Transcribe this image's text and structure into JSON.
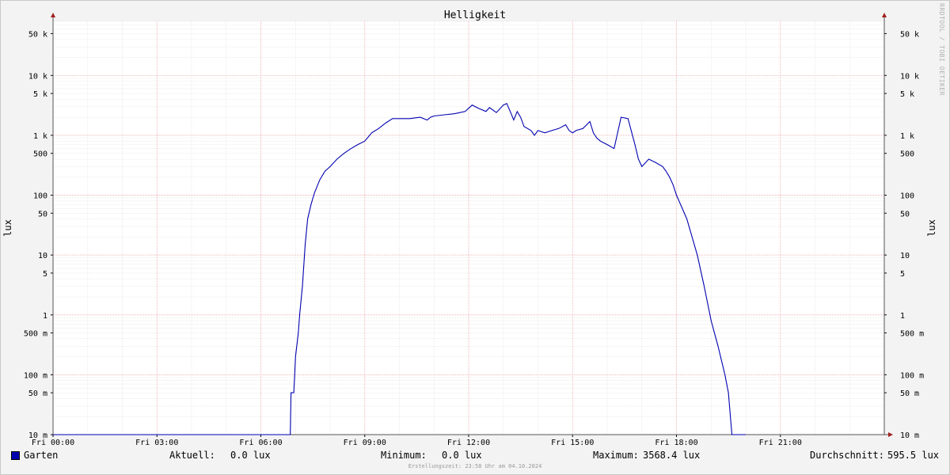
{
  "chart_data": {
    "type": "line",
    "title": "Helligkeit",
    "ylabel": "lux",
    "yscale": "log",
    "ylim": [
      0.01,
      80000
    ],
    "xlim_hours": [
      0,
      24
    ],
    "x_tick_labels": [
      "Fri 00:00",
      "Fri 03:00",
      "Fri 06:00",
      "Fri 09:00",
      "Fri 12:00",
      "Fri 15:00",
      "Fri 18:00",
      "Fri 21:00"
    ],
    "y_ticks": [
      {
        "value": 50000,
        "label": "50 k"
      },
      {
        "value": 10000,
        "label": "10 k"
      },
      {
        "value": 5000,
        "label": "5 k"
      },
      {
        "value": 1000,
        "label": "1 k"
      },
      {
        "value": 500,
        "label": "500"
      },
      {
        "value": 100,
        "label": "100"
      },
      {
        "value": 50,
        "label": "50"
      },
      {
        "value": 10,
        "label": "10"
      },
      {
        "value": 5,
        "label": "5"
      },
      {
        "value": 1,
        "label": "1"
      },
      {
        "value": 0.5,
        "label": "500 m"
      },
      {
        "value": 0.1,
        "label": "100 m"
      },
      {
        "value": 0.05,
        "label": "50 m"
      },
      {
        "value": 0.01,
        "label": "10 m"
      }
    ],
    "grid": true,
    "series": [
      {
        "name": "Garten",
        "color": "#0000b0",
        "x_hours": [
          0,
          1,
          2,
          3,
          4,
          5,
          6,
          6.85,
          6.87,
          6.95,
          7.0,
          7.08,
          7.12,
          7.2,
          7.28,
          7.35,
          7.45,
          7.55,
          7.7,
          7.85,
          8.0,
          8.2,
          8.4,
          8.6,
          8.8,
          9.0,
          9.2,
          9.4,
          9.6,
          9.8,
          9.9,
          10.0,
          10.3,
          10.6,
          10.8,
          10.9,
          11.0,
          11.3,
          11.6,
          11.9,
          12.1,
          12.3,
          12.5,
          12.6,
          12.8,
          13.0,
          13.1,
          13.2,
          13.3,
          13.4,
          13.5,
          13.6,
          13.7,
          13.8,
          13.9,
          14.0,
          14.2,
          14.4,
          14.6,
          14.8,
          14.9,
          15.0,
          15.1,
          15.3,
          15.5,
          15.6,
          15.7,
          15.8,
          16.0,
          16.2,
          16.4,
          16.6,
          16.8,
          16.9,
          17.0,
          17.2,
          17.4,
          17.6,
          17.7,
          17.8,
          17.9,
          18.0,
          18.3,
          18.6,
          18.8,
          19.0,
          19.2,
          19.4,
          19.5,
          19.6,
          19.7,
          19.8,
          19.85,
          19.9,
          19.95,
          20.0,
          21,
          22,
          23,
          24
        ],
        "values": [
          0.01,
          0.01,
          0.01,
          0.01,
          0.01,
          0.01,
          0.01,
          0.01,
          0.05,
          0.05,
          0.2,
          0.5,
          1,
          3,
          15,
          40,
          70,
          110,
          180,
          250,
          300,
          400,
          500,
          600,
          700,
          800,
          1100,
          1300,
          1600,
          1900,
          1900,
          1900,
          1900,
          2000,
          1800,
          2000,
          2100,
          2200,
          2300,
          2500,
          3200,
          2800,
          2500,
          2900,
          2400,
          3200,
          3400,
          2500,
          1800,
          2500,
          2000,
          1400,
          1300,
          1200,
          1000,
          1200,
          1100,
          1200,
          1300,
          1500,
          1200,
          1100,
          1200,
          1300,
          1700,
          1100,
          900,
          800,
          700,
          600,
          2000,
          1900,
          700,
          400,
          300,
          400,
          350,
          300,
          250,
          200,
          150,
          100,
          40,
          10,
          3,
          0.8,
          0.3,
          0.1,
          0.05,
          0.01,
          0.01,
          0.01,
          0.01,
          0.01,
          0.01,
          0.01
        ]
      }
    ]
  },
  "legend": {
    "series_name": "Garten",
    "current_label": "Aktuell:",
    "current_value": "0.0 lux",
    "min_label": "Minimum:",
    "min_value": "0.0 lux",
    "max_label": "Maximum:",
    "max_value": "3568.4 lux",
    "avg_label": "Durchschnitt:",
    "avg_value": "595.5 lux"
  },
  "footer": "Erstellungszeit: 23:58 Uhr am 04.10.2024",
  "watermark": "RRDTOOL / TOBI OETIKER"
}
